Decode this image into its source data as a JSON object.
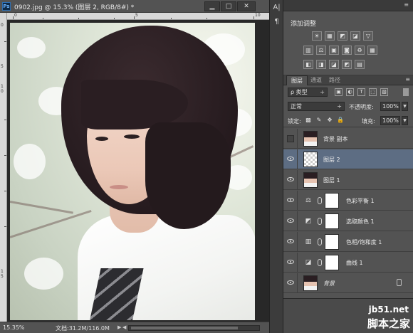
{
  "document": {
    "ps_badge": "Ps",
    "title": "0902.jpg @ 15.3% (图层 2, RGB/8#) *",
    "buttons": {
      "minimize": "▁",
      "maximize": "□",
      "close": "✕"
    },
    "ruler_top_numbers": [
      "0",
      "5",
      "10"
    ],
    "ruler_left_numbers": [
      "0",
      "5",
      "1 0",
      "1 5"
    ],
    "status": {
      "zoom": "15.35%",
      "doc_size": "文档:31.2M/116.0M",
      "arrow": "▶",
      "left_arrow": "◀"
    }
  },
  "side_strip": {
    "icons": [
      "A|",
      "¶"
    ]
  },
  "adjustments": {
    "title": "添加调整",
    "row1": [
      "☀",
      "▦",
      "◩",
      "◪",
      "▽"
    ],
    "row2": [
      "▥",
      "⚖",
      "▣",
      "◙",
      "♻",
      "▦"
    ],
    "row3": [
      "◧",
      "◨",
      "◪",
      "◩",
      "▤"
    ]
  },
  "layers_panel": {
    "tabs": [
      "图层",
      "通道",
      "路径"
    ],
    "filter": {
      "label": "ρ 类型",
      "arrow": "÷",
      "icons": [
        "▣",
        "◐",
        "T",
        "⬚",
        "▧"
      ]
    },
    "blend_mode": {
      "value": "正常",
      "arrow": "÷"
    },
    "opacity": {
      "label": "不透明度:",
      "value": "100%"
    },
    "lock": {
      "label": "锁定:",
      "icons": [
        "▩",
        "✎",
        "✥",
        "🔒"
      ]
    },
    "fill": {
      "label": "填充:",
      "value": "100%"
    },
    "layers": [
      {
        "name": "背景 副本",
        "visible": false,
        "kind": "photo"
      },
      {
        "name": "图层 2",
        "visible": true,
        "kind": "checker",
        "selected": true
      },
      {
        "name": "图层 1",
        "visible": true,
        "kind": "photo"
      },
      {
        "name": "色彩平衡 1",
        "visible": true,
        "kind": "adjust",
        "glyph": "⚖"
      },
      {
        "name": "选取颜色 1",
        "visible": true,
        "kind": "adjust",
        "glyph": "◩"
      },
      {
        "name": "色相/饱和度 1",
        "visible": true,
        "kind": "adjust",
        "glyph": "▥"
      },
      {
        "name": "曲线 1",
        "visible": true,
        "kind": "adjust",
        "glyph": "◪"
      },
      {
        "name": "背景",
        "visible": true,
        "kind": "photo",
        "locked": true,
        "italic": true
      }
    ],
    "menu_icon": "≡"
  },
  "watermark": {
    "site": "jb51.net",
    "brand": "脚本之家"
  }
}
